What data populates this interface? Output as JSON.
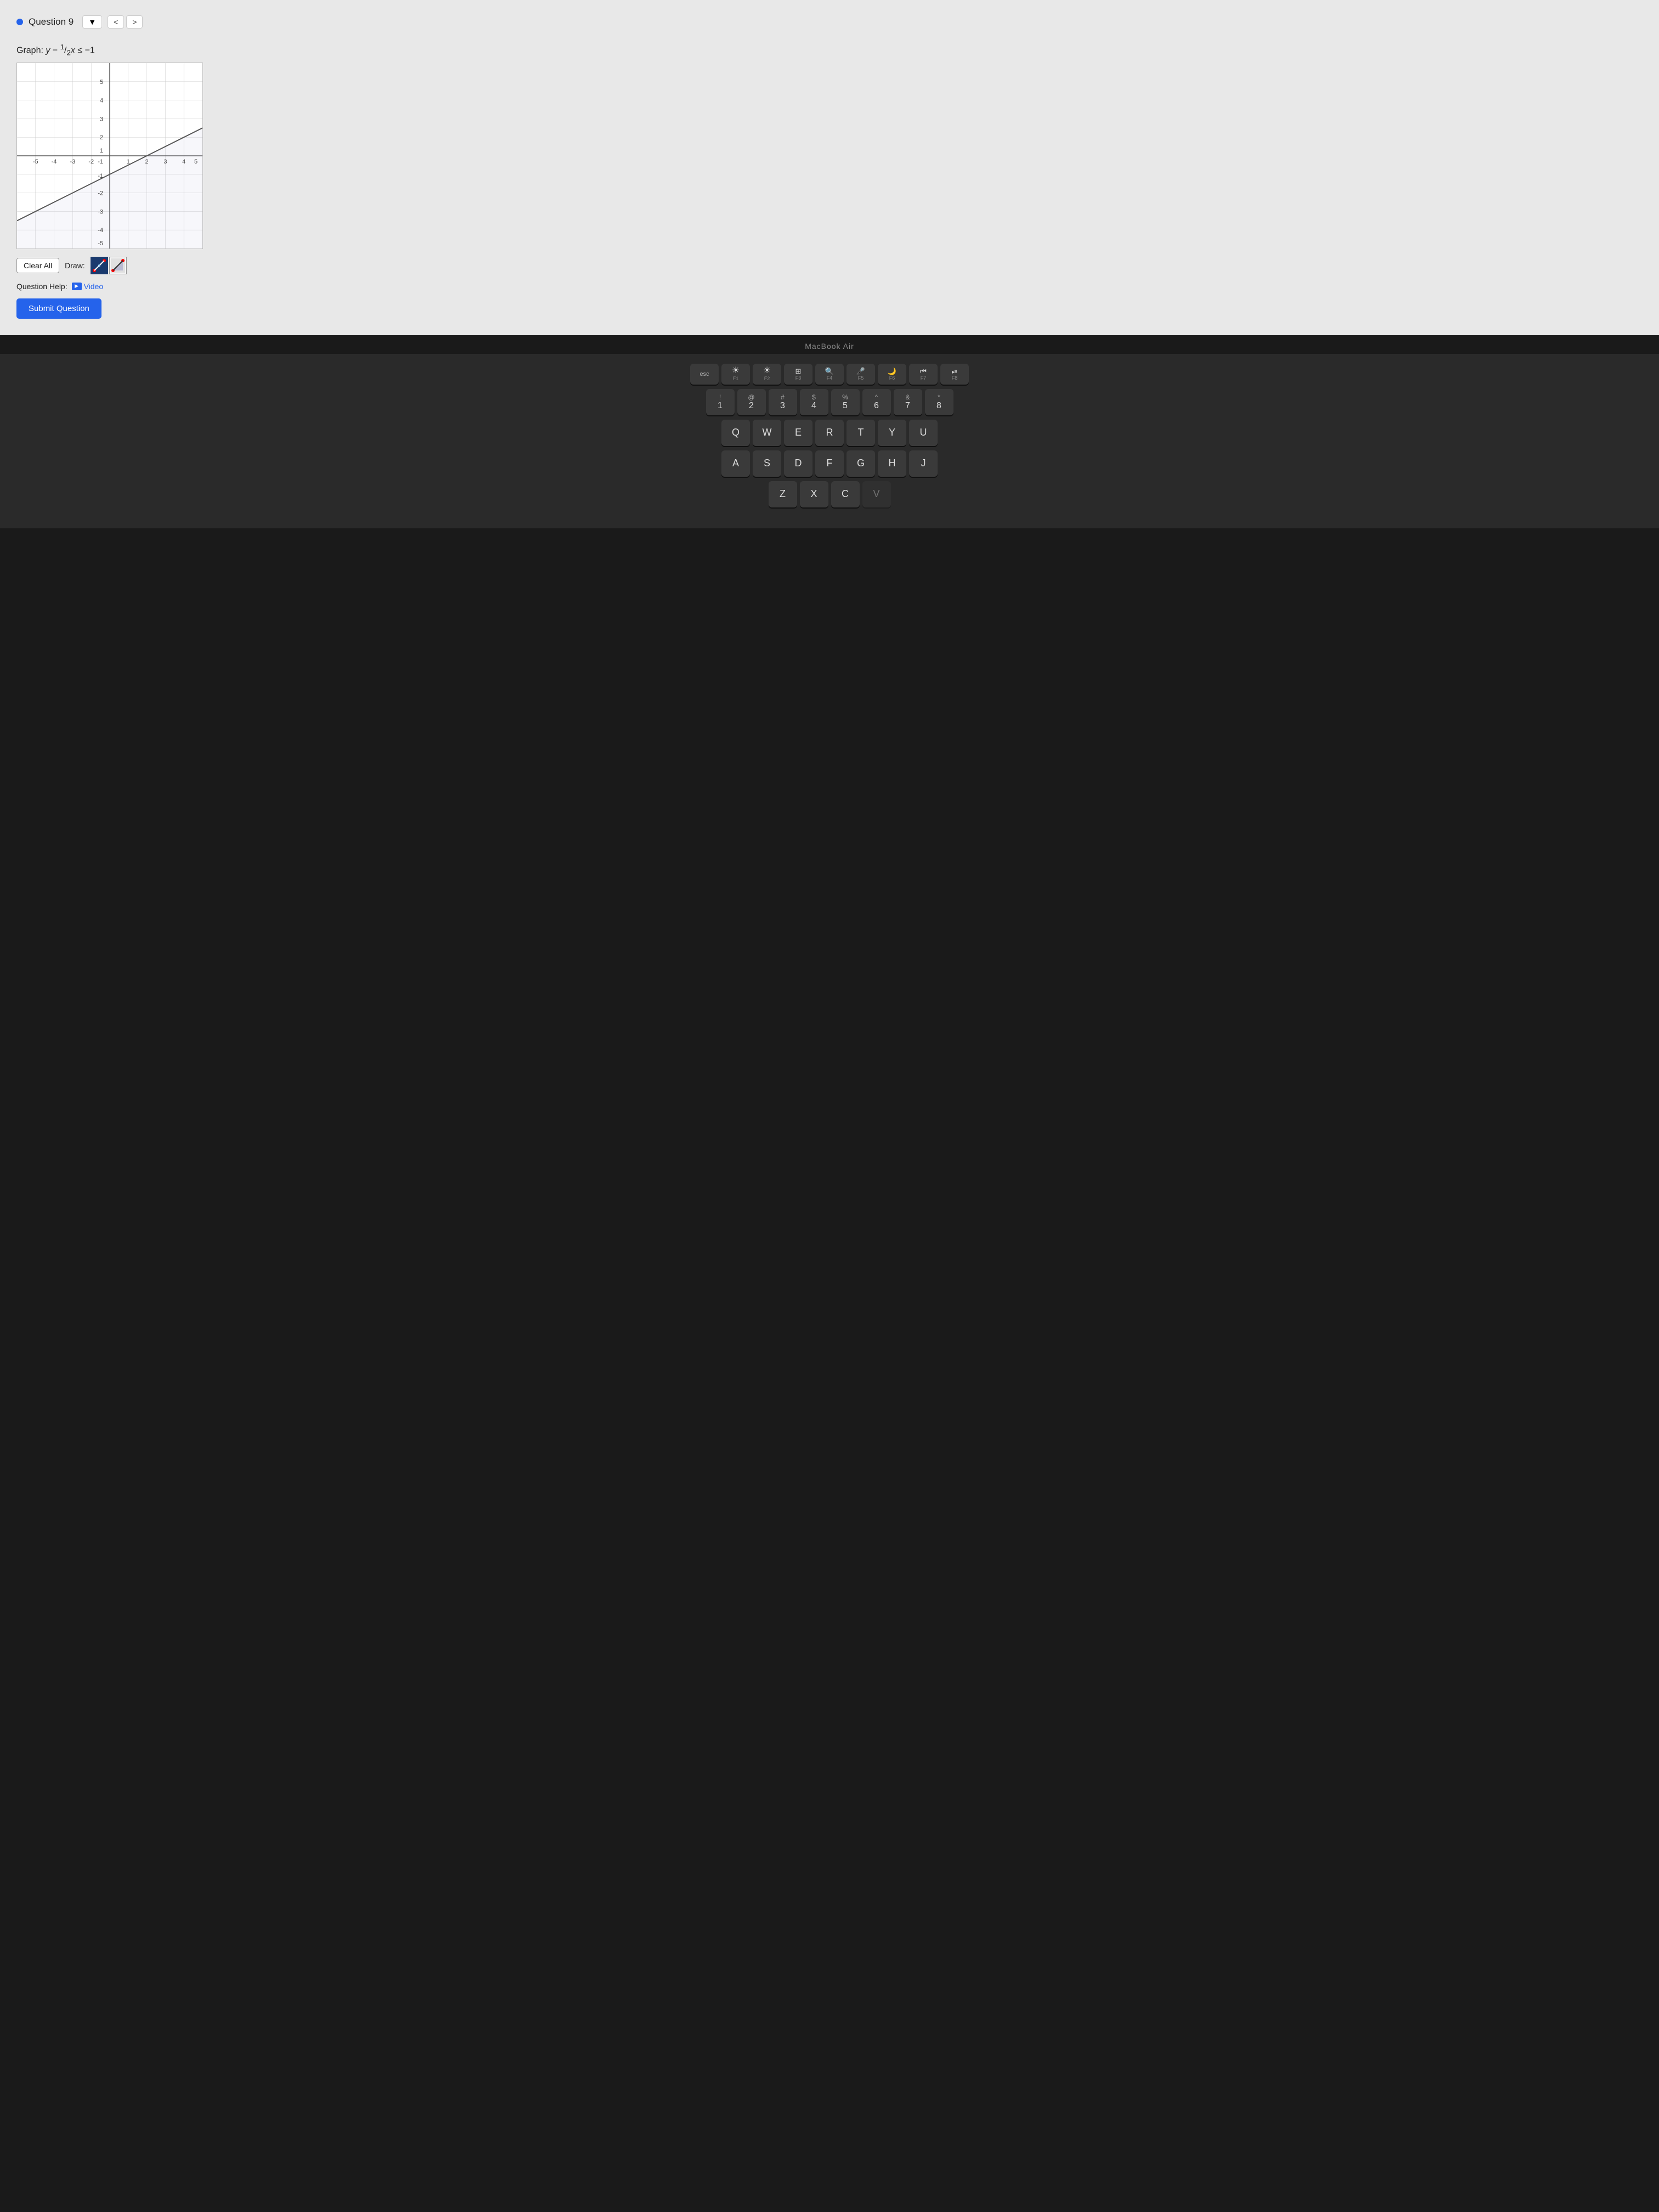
{
  "question": {
    "title": "Question 9",
    "instruction": "Graph: y −",
    "fraction": "1/2",
    "instruction_rest": "x ≤ −1",
    "nav_dropdown_label": "▼",
    "nav_prev": "<",
    "nav_next": ">"
  },
  "graph": {
    "x_min": -5,
    "x_max": 5,
    "y_min": -5,
    "y_max": 5,
    "x_labels": [
      "-5",
      "-4",
      "-3",
      "-2",
      "-1",
      "",
      "1",
      "2",
      "3",
      "4",
      "5"
    ],
    "y_labels": [
      "-5",
      "-4",
      "-3",
      "-2",
      "-1",
      "1",
      "2",
      "3",
      "4",
      "5"
    ]
  },
  "controls": {
    "clear_all_label": "Clear All",
    "draw_label": "Draw:",
    "tool1_icon": "✏️",
    "tool2_icon": "📐"
  },
  "help": {
    "label": "Question Help:",
    "video_label": "Video"
  },
  "submit": {
    "label": "Submit Question"
  },
  "macbook": {
    "label": "MacBook Air"
  },
  "keyboard": {
    "fn_keys": [
      {
        "icon": "☀",
        "label": "F1"
      },
      {
        "icon": "☀",
        "label": "F2"
      },
      {
        "icon": "⊞",
        "label": "F3"
      },
      {
        "icon": "Q",
        "label": "F4"
      },
      {
        "icon": "🎤",
        "label": "F5"
      },
      {
        "icon": "🌙",
        "label": "F6"
      },
      {
        "icon": "⏮",
        "label": "F7"
      },
      {
        "icon": "⏯",
        "label": "F8"
      }
    ],
    "num_row": [
      {
        "top": "!",
        "bottom": "1"
      },
      {
        "top": "@",
        "bottom": "2"
      },
      {
        "top": "#",
        "bottom": "3"
      },
      {
        "top": "$",
        "bottom": "4"
      },
      {
        "top": "%",
        "bottom": "5"
      },
      {
        "top": "^",
        "bottom": "6"
      },
      {
        "top": "&",
        "bottom": "7"
      },
      {
        "top": "*",
        "bottom": "8"
      }
    ],
    "row_q": [
      "Q",
      "W",
      "E",
      "R",
      "T",
      "Y",
      "U"
    ],
    "row_a": [
      "A",
      "S",
      "D",
      "F",
      "G",
      "H",
      "J"
    ]
  }
}
